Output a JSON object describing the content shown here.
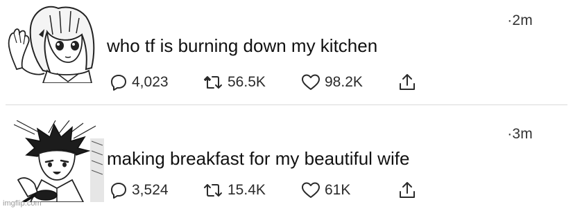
{
  "tweets": [
    {
      "time": "·2m",
      "text": "who tf is burning down my kitchen",
      "actions": {
        "replies": "4,023",
        "retweets": "56.5K",
        "likes": "98.2K"
      }
    },
    {
      "time": "·3m",
      "text": "making breakfast for my beautiful wife",
      "actions": {
        "replies": "3,524",
        "retweets": "15.4K",
        "likes": "61K"
      }
    }
  ],
  "icons": {
    "reply": "reply-icon",
    "retweet": "retweet-icon",
    "like": "heart-icon",
    "share": "share-icon"
  },
  "watermark": "imgflip.com"
}
